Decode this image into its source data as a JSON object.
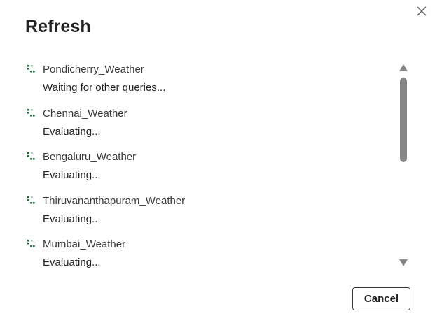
{
  "dialog": {
    "title": "Refresh",
    "close_icon": "close-icon"
  },
  "queries": [
    {
      "name": "Pondicherry_Weather",
      "status": "Waiting for other queries...",
      "icon": "loading-spinner-icon"
    },
    {
      "name": "Chennai_Weather",
      "status": "Evaluating...",
      "icon": "loading-spinner-icon"
    },
    {
      "name": "Bengaluru_Weather",
      "status": "Evaluating...",
      "icon": "loading-spinner-icon"
    },
    {
      "name": "Thiruvananthapuram_Weather",
      "status": "Evaluating...",
      "icon": "loading-spinner-icon"
    },
    {
      "name": "Mumbai_Weather",
      "status": "Evaluating...",
      "icon": "loading-spinner-icon"
    }
  ],
  "footer": {
    "cancel_label": "Cancel"
  },
  "colors": {
    "spinner": "#1e6b3c",
    "text": "#252423",
    "scrollbar_thumb": "#868686"
  }
}
